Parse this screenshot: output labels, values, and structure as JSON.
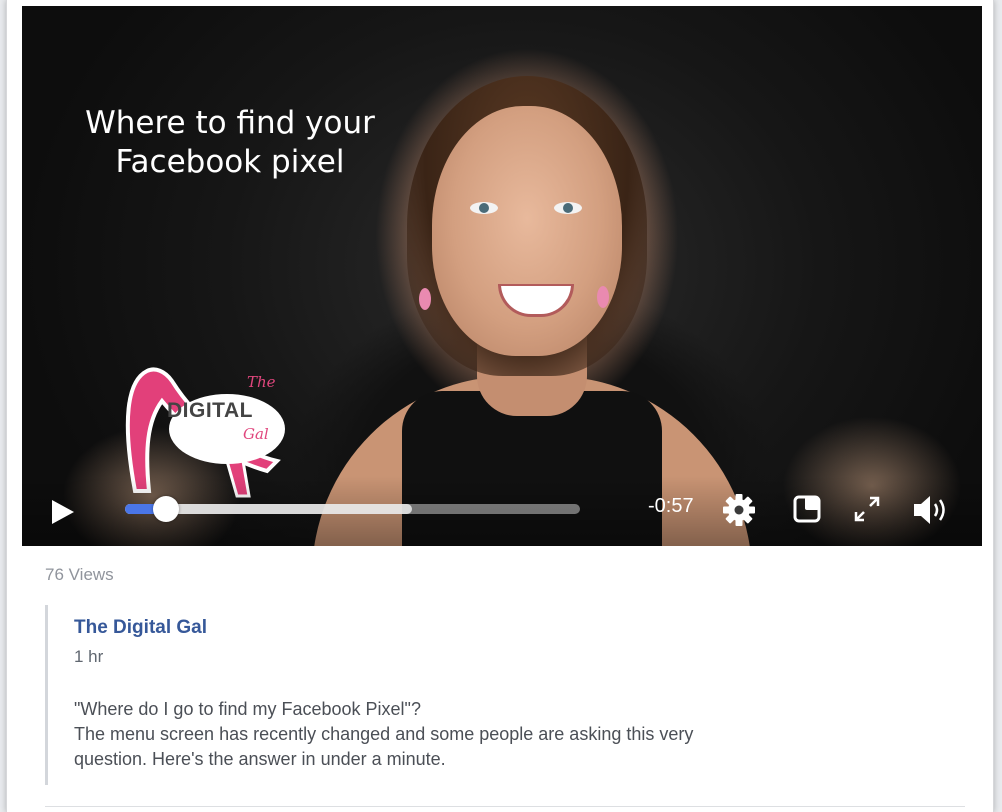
{
  "video": {
    "overlay_title_line1": "Where to find your",
    "overlay_title_line2": "Facebook pixel",
    "logo_the": "The",
    "logo_main": "DIGITAL",
    "logo_gal": "Gal",
    "controls": {
      "time_remaining": "-0:57",
      "played_fraction": 0.09,
      "buffered_fraction": 0.63,
      "play_icon": "play-icon",
      "settings_icon": "gear-icon",
      "pip_icon": "picture-in-picture-icon",
      "fullscreen_icon": "fullscreen-icon",
      "volume_icon": "volume-icon"
    },
    "accent_color": "#4a76e8"
  },
  "post": {
    "views": "76 Views",
    "author": "The Digital Gal",
    "time_ago": "1 hr",
    "description_line1": "\"Where do I go to find my Facebook Pixel\"?",
    "description_line2": "The menu screen has recently changed and some people are asking this very",
    "description_line3": "question. Here's the answer in under a minute.",
    "author_color": "#365899"
  }
}
